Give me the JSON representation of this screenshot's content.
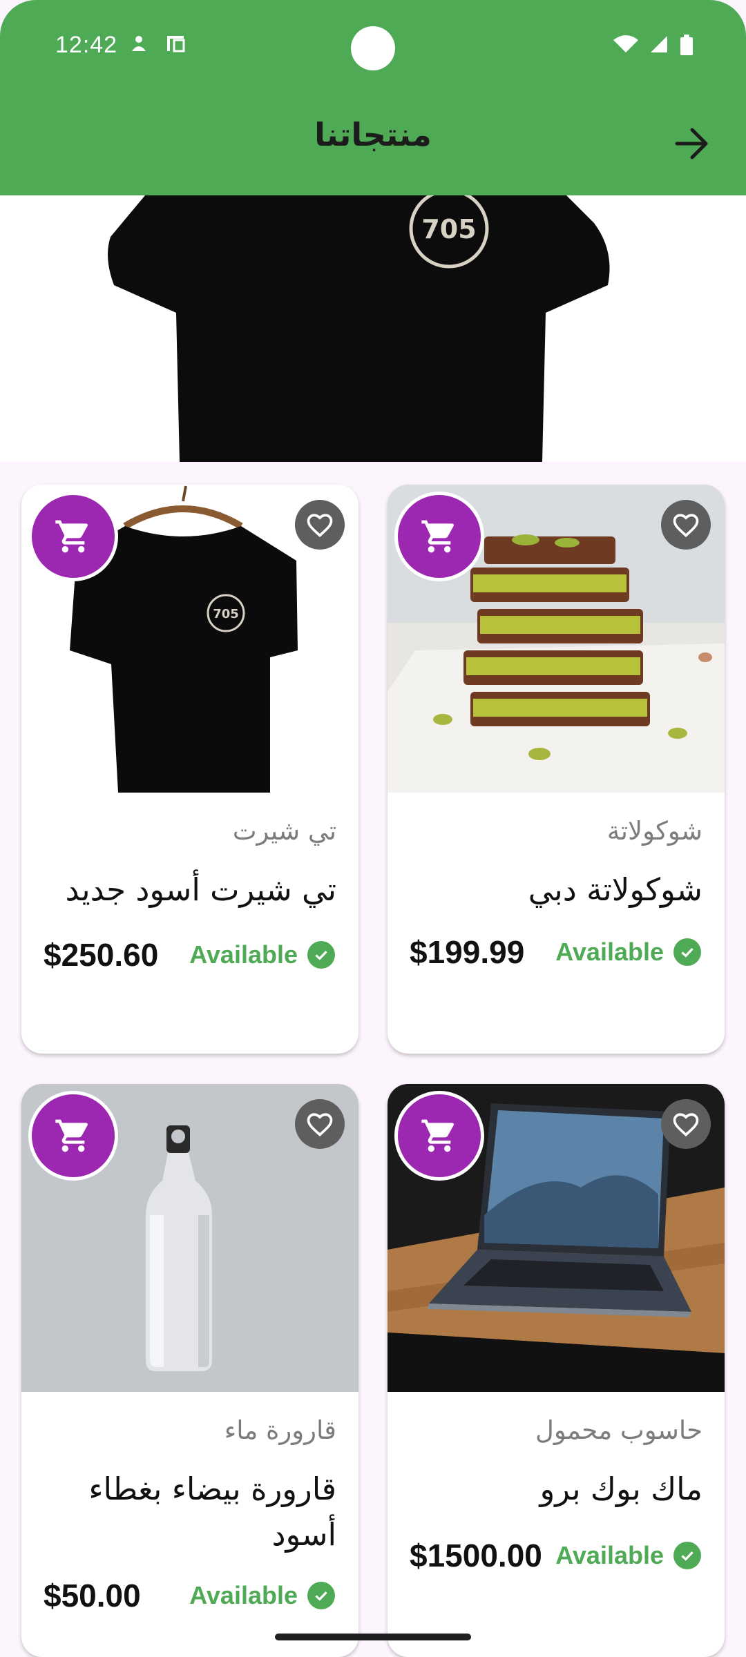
{
  "status_bar": {
    "time": "12:42"
  },
  "app_bar": {
    "title": "منتجاتنا",
    "back_icon": "arrow-right-icon"
  },
  "banner": {
    "logo_text": "705"
  },
  "products": [
    {
      "category": "تي شيرت",
      "name": "تي شيرت أسود جديد",
      "price": "$250.60",
      "availability": "Available",
      "image": "black-tshirt"
    },
    {
      "category": "شوكولاتة",
      "name": "شوكولاتة دبي",
      "price": "$199.99",
      "availability": "Available",
      "image": "pistachio-chocolate"
    },
    {
      "category": "قارورة ماء",
      "name": "قارورة بيضاء بغطاء أسود",
      "price": "$50.00",
      "availability": "Available",
      "image": "water-bottle"
    },
    {
      "category": "حاسوب محمول",
      "name": "ماك بوك برو",
      "price": "$1500.00",
      "availability": "Available",
      "image": "laptop"
    }
  ],
  "colors": {
    "app_bar": "#4faa55",
    "cart_button": "#9c27b0",
    "available": "#4faa55",
    "page_background": "#fdf5fd"
  }
}
